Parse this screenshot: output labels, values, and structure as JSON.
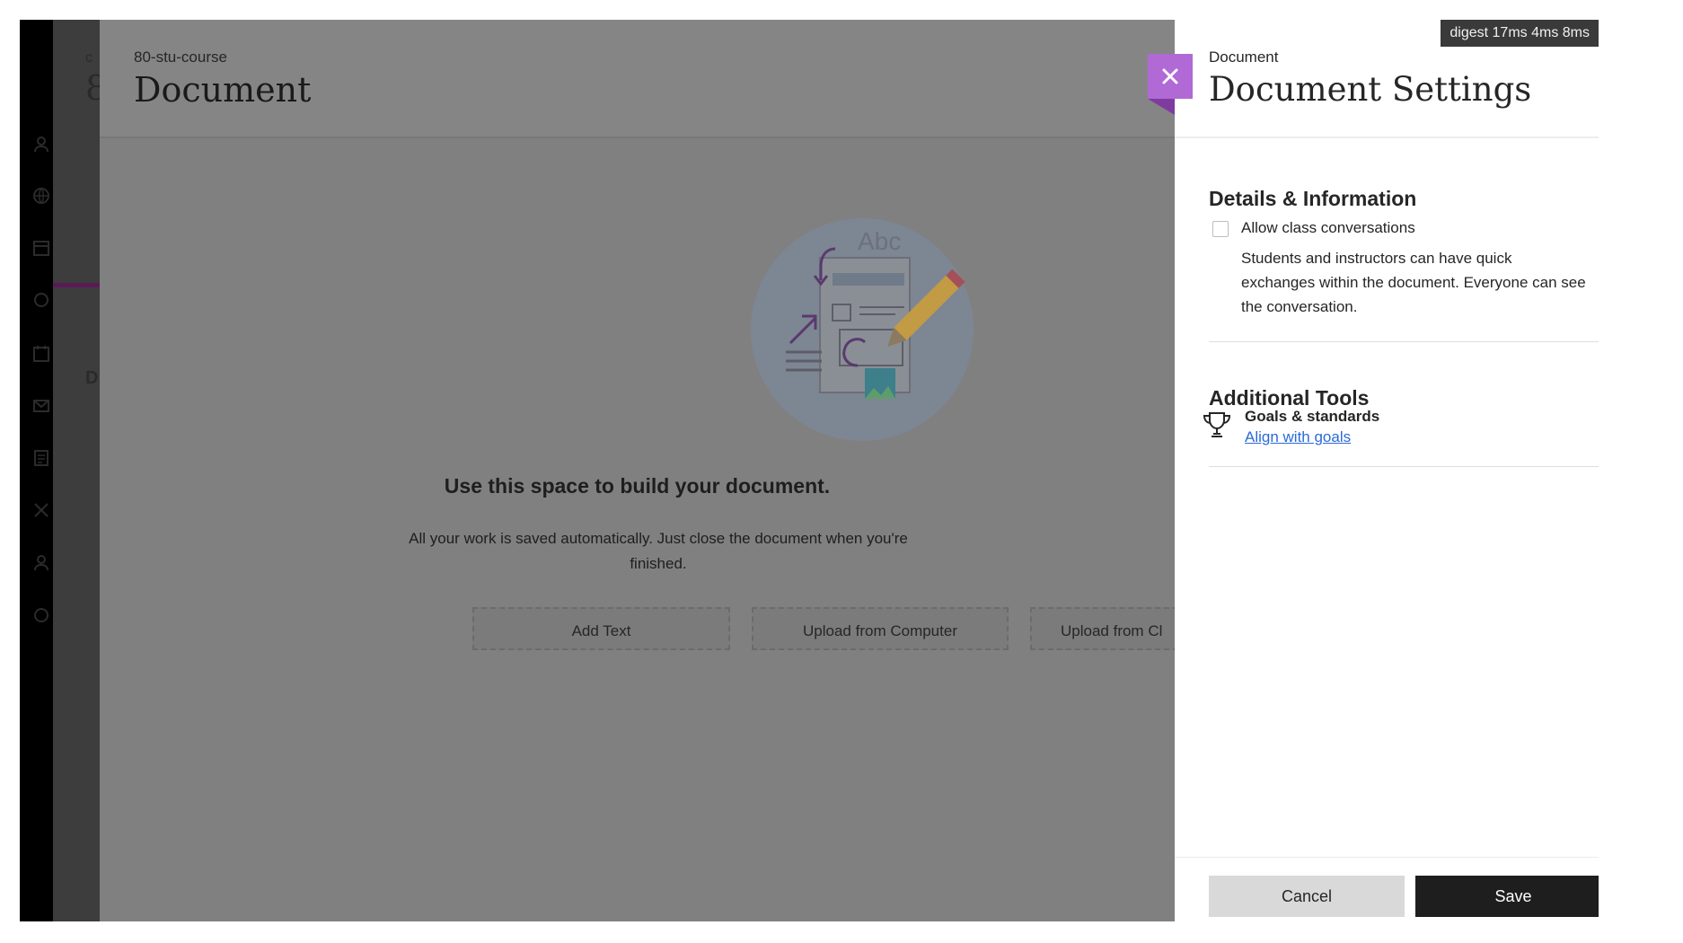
{
  "background": {
    "nav_fragments": [
      "c",
      "8",
      "D"
    ],
    "breadcrumb": "80-stu-course",
    "title": "Document",
    "empty_state": {
      "heading": "Use this space to build your document.",
      "subtext_line1": "All your work is saved automatically. Just close the document when you're",
      "subtext_line2": "finished.",
      "illustration_text": "Abc"
    },
    "action_buttons": [
      "Add Text",
      "Upload from Computer",
      "Upload from Cl"
    ]
  },
  "panel": {
    "breadcrumb": "Document",
    "title": "Document Settings",
    "digest": "digest 17ms 4ms 8ms",
    "details_heading": "Details & Information",
    "allow_conversations_label": "Allow class conversations",
    "allow_conversations_checked": false,
    "allow_conversations_desc_line1": "Students and instructors can have quick",
    "allow_conversations_desc_line2": "exchanges within the document. Everyone can see",
    "allow_conversations_desc_line3": "the conversation.",
    "tools_heading": "Additional Tools",
    "goals_title": "Goals & standards",
    "goals_link": "Align with goals",
    "cancel_label": "Cancel",
    "save_label": "Save"
  },
  "colors": {
    "close_button": "#b169d6",
    "link": "#2b6ad9",
    "save_button": "#1e1e1e",
    "cancel_button": "#d9d9d9",
    "accent_strip": "#5a1a56"
  },
  "icons": [
    "close-icon",
    "trophy-icon",
    "document-illustration",
    "nav-user-icon",
    "nav-globe-icon",
    "nav-calendar-icon",
    "nav-mail-icon"
  ]
}
